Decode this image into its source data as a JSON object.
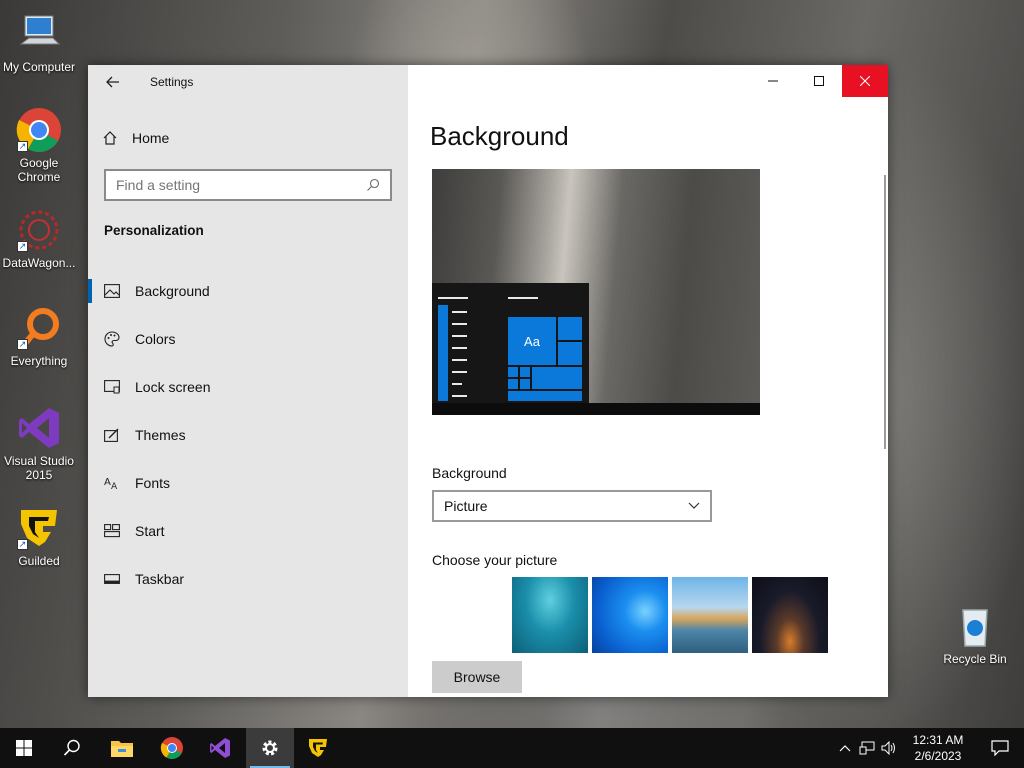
{
  "desktop": {
    "icons": [
      {
        "label": "My Computer"
      },
      {
        "label": "Google Chrome"
      },
      {
        "label": "DataWagon..."
      },
      {
        "label": "Everything"
      },
      {
        "label": "Visual Studio 2015"
      },
      {
        "label": "Guilded"
      },
      {
        "label": "Recycle Bin"
      }
    ]
  },
  "window": {
    "title": "Settings",
    "nav": {
      "home_label": "Home",
      "search_placeholder": "Find a setting",
      "section_title": "Personalization",
      "items": [
        {
          "label": "Background",
          "icon": "picture-icon",
          "active": true
        },
        {
          "label": "Colors",
          "icon": "palette-icon"
        },
        {
          "label": "Lock screen",
          "icon": "lock-screen-icon"
        },
        {
          "label": "Themes",
          "icon": "themes-icon"
        },
        {
          "label": "Fonts",
          "icon": "fonts-icon"
        },
        {
          "label": "Start",
          "icon": "start-icon"
        },
        {
          "label": "Taskbar",
          "icon": "taskbar-icon"
        }
      ]
    },
    "content": {
      "page_title": "Background",
      "preview_tile_text": "Aa",
      "background_label": "Background",
      "background_value": "Picture",
      "choose_picture_label": "Choose your picture",
      "browse_label": "Browse"
    }
  },
  "taskbar": {
    "apps": [
      "start-icon",
      "search-icon",
      "file-explorer-icon",
      "chrome-icon",
      "visual-studio-icon",
      "settings-icon",
      "guilded-icon"
    ],
    "active_app": "settings-icon",
    "clock": {
      "time": "12:31 AM",
      "date": "2/6/2023"
    }
  },
  "colors": {
    "accent": "#0063b1",
    "close": "#e81123",
    "tile": "#0b79d9"
  }
}
